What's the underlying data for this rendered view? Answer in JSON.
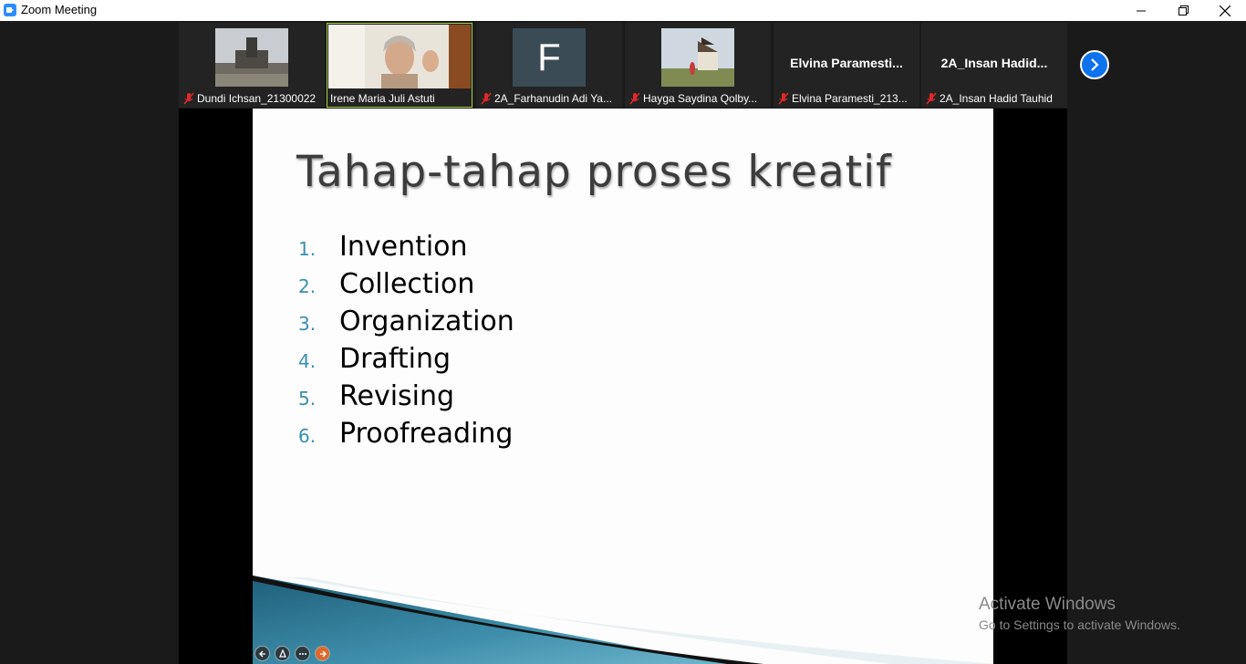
{
  "window": {
    "title": "Zoom Meeting",
    "accent": "#2d8cff",
    "active_speaker_border": "#a6d346"
  },
  "participants": [
    {
      "name": "Dundi Ichsan_21300022",
      "muted": true,
      "video": "photo-monument"
    },
    {
      "name": "Irene Maria Juli Astuti",
      "muted": false,
      "active": true,
      "video": "photo-speaker"
    },
    {
      "name": "2A_Farhanudin Adi Ya...",
      "muted": true,
      "avatar_letter": "F"
    },
    {
      "name": "Hayga Saydina Qolby...",
      "muted": true,
      "video": "photo-outdoor"
    },
    {
      "name": "Elvina Paramesti_213...",
      "display_name": "Elvina  Paramesti...",
      "muted": true
    },
    {
      "name": "2A_Insan Hadid Tauhid",
      "display_name": "2A_Insan  Hadid...",
      "muted": true
    }
  ],
  "slide": {
    "title": "Tahap-tahap proses kreatif",
    "items": [
      {
        "num": "1.",
        "text": "Invention"
      },
      {
        "num": "2.",
        "text": "Collection"
      },
      {
        "num": "3.",
        "text": "Organization"
      },
      {
        "num": "4.",
        "text": "Drafting"
      },
      {
        "num": "5.",
        "text": "Revising"
      },
      {
        "num": "6.",
        "text": "Proofreading"
      }
    ],
    "number_color": "#3a8fb0"
  },
  "watermark": {
    "line1": "Activate Windows",
    "line2": "Go to Settings to activate Windows."
  }
}
